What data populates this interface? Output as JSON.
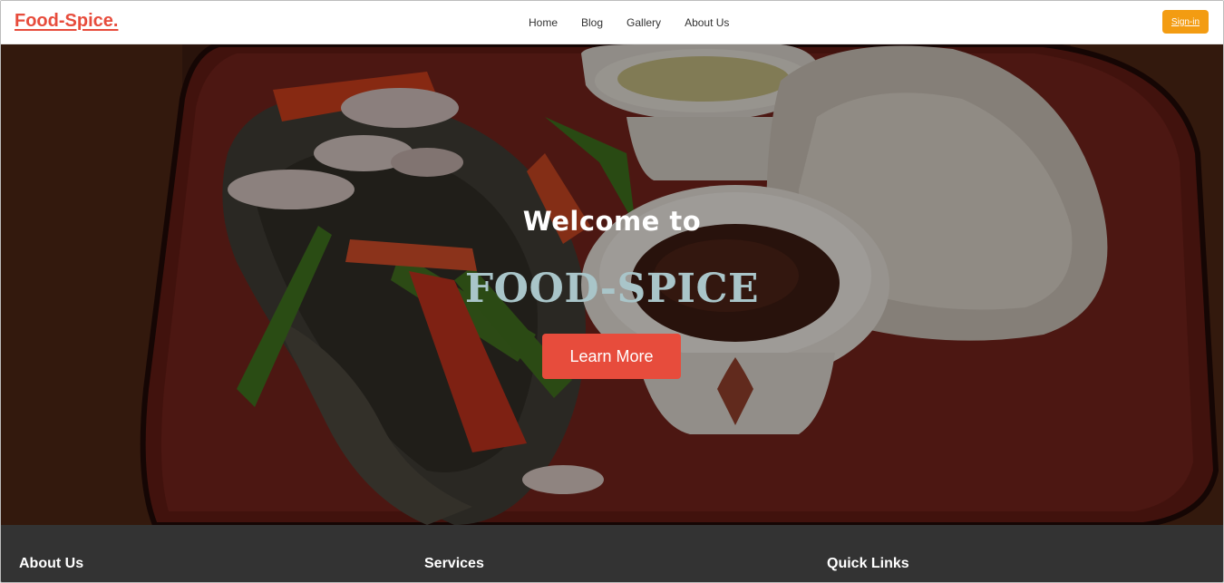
{
  "navbar": {
    "brand": "Food-Spice.",
    "links": [
      "Home",
      "Blog",
      "Gallery",
      "About Us"
    ],
    "signin_label": "Sign-in"
  },
  "hero": {
    "welcome": "Welcome to",
    "brand_name": "FOOD-SPICE",
    "button_label": "Learn More"
  },
  "footer": {
    "headings": [
      "About Us",
      "Services",
      "Quick Links"
    ]
  },
  "colors": {
    "accent": "#e74c3c",
    "signin": "#f39c12",
    "footer_bg": "#333333",
    "hero_brand": "#a9c5c9"
  }
}
